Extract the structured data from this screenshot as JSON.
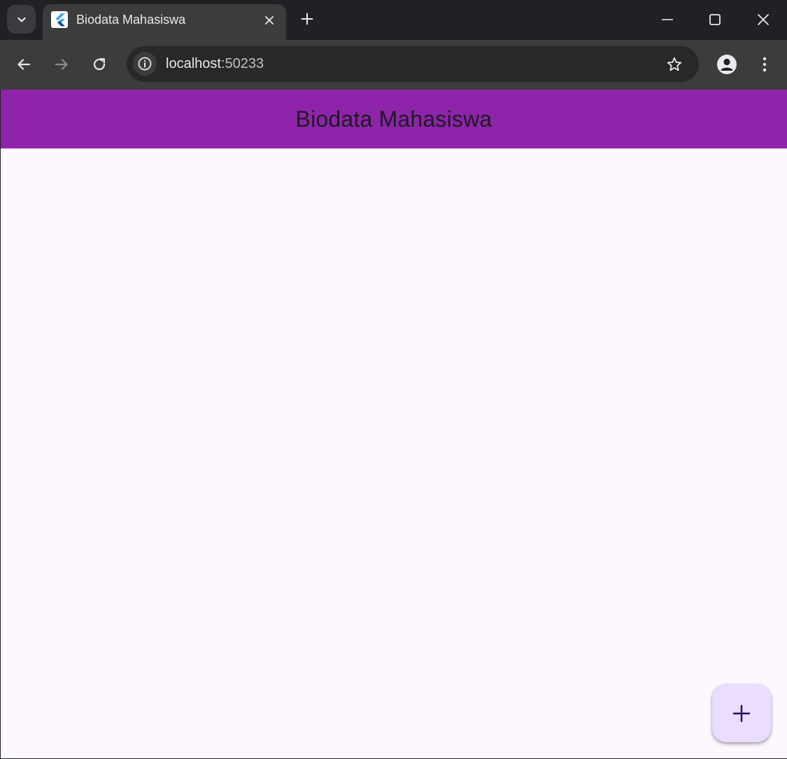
{
  "browser": {
    "tab": {
      "title": "Biodata Mahasiswa"
    },
    "address_bar": {
      "host": "localhost",
      "port": ":50233"
    }
  },
  "app": {
    "appbar_title": "Biodata Mahasiswa",
    "colors": {
      "appbar": "#8e24aa",
      "background": "#fdf7ff",
      "fab": "#eaddff",
      "fab_icon": "#21005d"
    },
    "fab_icon": "add-icon"
  }
}
